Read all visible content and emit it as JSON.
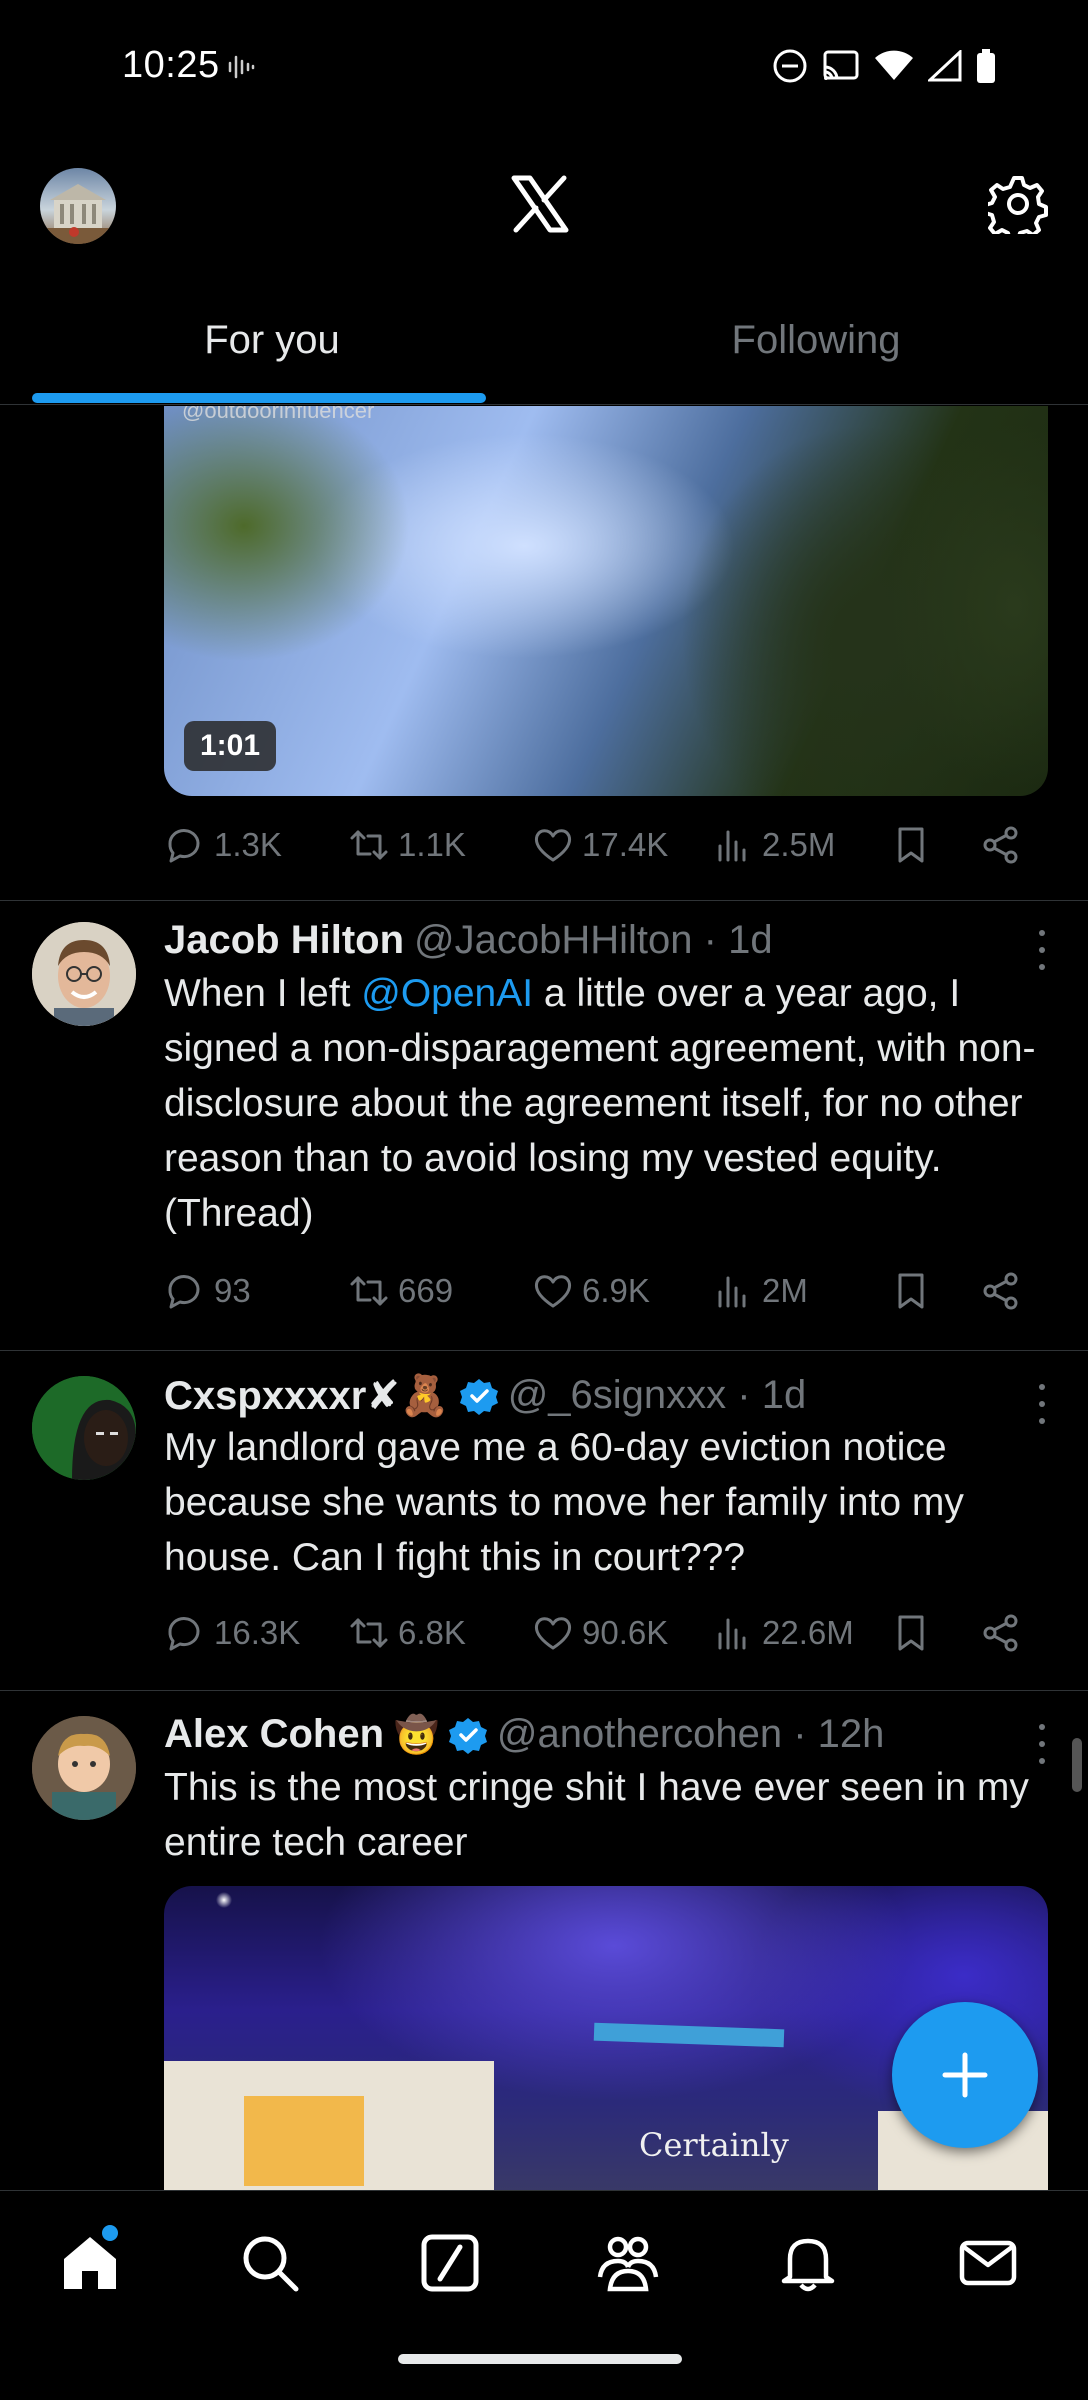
{
  "status_bar": {
    "time": "10:25",
    "icons": [
      "sound-wave-icon",
      "do-not-disturb-icon",
      "cast-icon",
      "wifi-icon",
      "signal-icon",
      "battery-icon"
    ]
  },
  "header": {
    "logo": "X",
    "icons": [
      "profile-avatar",
      "x-logo-icon",
      "gear-icon"
    ]
  },
  "tabs": [
    {
      "label": "For you",
      "active": true
    },
    {
      "label": "Following",
      "active": false
    }
  ],
  "feed": {
    "top_media": {
      "watermark": "@outdoorinfluencer",
      "duration": "1:01",
      "stats": {
        "replies": "1.3K",
        "reposts": "1.1K",
        "likes": "17.4K",
        "views": "2.5M"
      }
    },
    "tweets": [
      {
        "name": "Jacob Hilton",
        "handle": "@JacobHHilton · 1d",
        "text_before": "When I left ",
        "mention": "@OpenAI",
        "text_after": " a little over a year ago, I signed a non-disparagement agreement, with non-disclosure about the agreement itself, for no other reason than to avoid losing my vested equity. (Thread)",
        "stats": {
          "replies": "93",
          "reposts": "669",
          "likes": "6.9K",
          "views": "2M"
        }
      },
      {
        "name": "Cxspxxxxr✘🧸",
        "handle": "@_6signxxx · 1d",
        "verified": true,
        "text": "My landlord gave me a 60-day eviction notice because she wants to move her family into my house. Can I fight this in court???",
        "stats": {
          "replies": "16.3K",
          "reposts": "6.8K",
          "likes": "90.6K",
          "views": "22.6M"
        }
      },
      {
        "name": "Alex Cohen",
        "emoji": "🤠",
        "handle": "@anothercohen · 12h",
        "verified": true,
        "text": "This is the most cringe shit I have ever seen in my entire tech career",
        "media_caption": "Certainly"
      }
    ]
  },
  "fab": {
    "icon": "plus-icon"
  },
  "bottom_nav": {
    "items": [
      "home-icon",
      "search-icon",
      "grok-icon",
      "communities-icon",
      "notifications-icon",
      "messages-icon"
    ],
    "active": "home-icon",
    "home_has_dot": true
  },
  "colors": {
    "accent": "#1d9bf0",
    "background": "#000000",
    "muted": "#71767b",
    "text": "#e7e9ea"
  }
}
